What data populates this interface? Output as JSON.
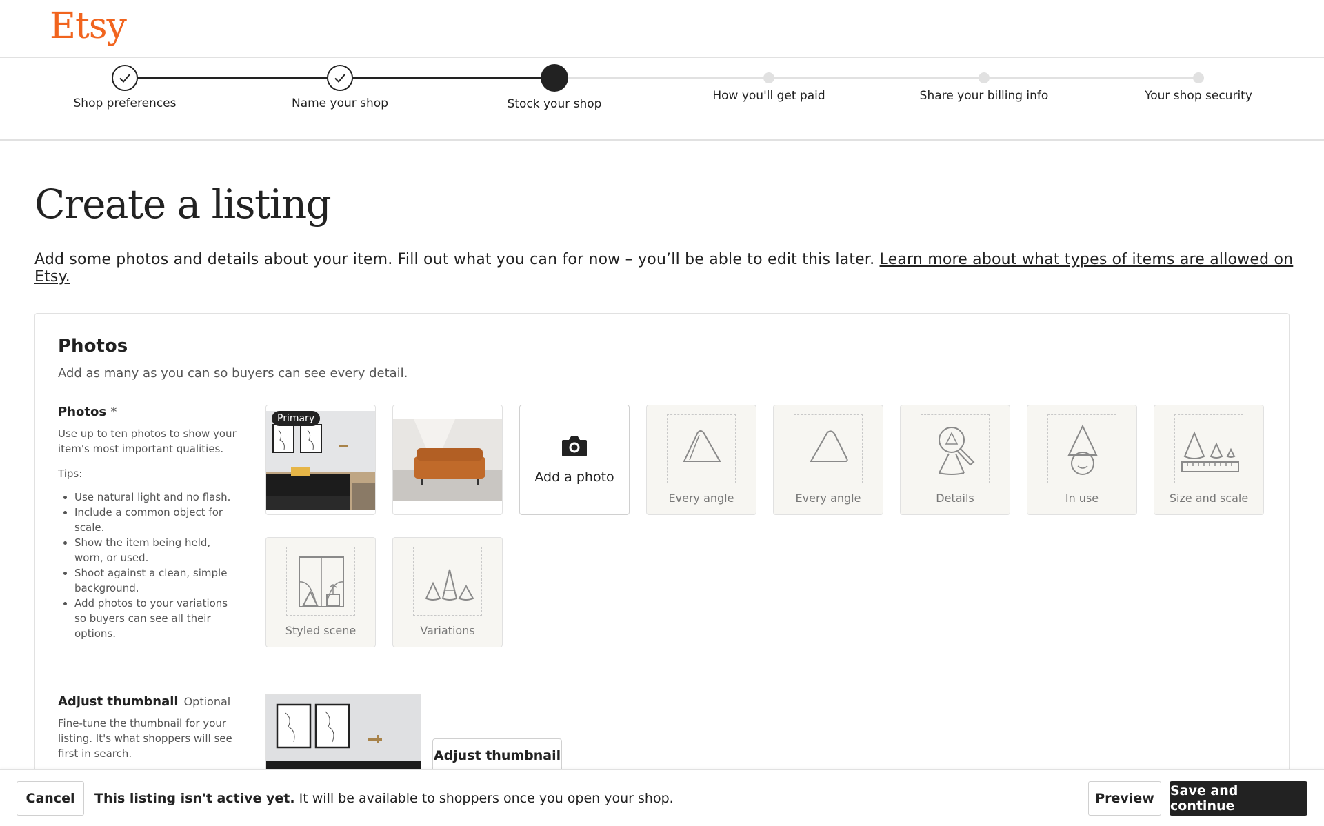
{
  "brand": {
    "logo": "Etsy",
    "accent": "#f1641e"
  },
  "stepper": {
    "steps": [
      {
        "label": "Shop preferences",
        "state": "done"
      },
      {
        "label": "Name your shop",
        "state": "done"
      },
      {
        "label": "Stock your shop",
        "state": "current"
      },
      {
        "label": "How you'll get paid",
        "state": "todo"
      },
      {
        "label": "Share your billing info",
        "state": "todo"
      },
      {
        "label": "Your shop security",
        "state": "todo"
      }
    ]
  },
  "page": {
    "title": "Create a listing",
    "intro": "Add some photos and details about your item. Fill out what you can for now – you’ll be able to edit this later.",
    "intro_link": "Learn more about what types of items are allowed on Etsy."
  },
  "photos_section": {
    "title": "Photos",
    "subtitle": "Add as many as you can so buyers can see every detail.",
    "field_label": "Photos",
    "required_mark": "*",
    "help": "Use up to ten photos to show your item's most important qualities.",
    "tips_label": "Tips:",
    "tips": [
      "Use natural light and no flash.",
      "Include a common object for scale.",
      "Show the item being held, worn, or used.",
      "Shoot against a clean, simple background.",
      "Add photos to your variations so buyers can see all their options."
    ],
    "primary_badge": "Primary",
    "add_photo_label": "Add a photo",
    "slots": [
      "Every angle",
      "Every angle",
      "Details",
      "In use",
      "Size and scale",
      "Styled scene",
      "Variations"
    ]
  },
  "thumbnail_section": {
    "title": "Adjust thumbnail",
    "optional": "Optional",
    "help": "Fine-tune the thumbnail for your listing. It's what shoppers will see first in search.",
    "button": "Adjust thumbnail"
  },
  "footer": {
    "cancel": "Cancel",
    "notice_bold": "This listing isn't active yet.",
    "notice_rest": "It will be available to shoppers once you open your shop.",
    "preview": "Preview",
    "save": "Save and continue"
  }
}
